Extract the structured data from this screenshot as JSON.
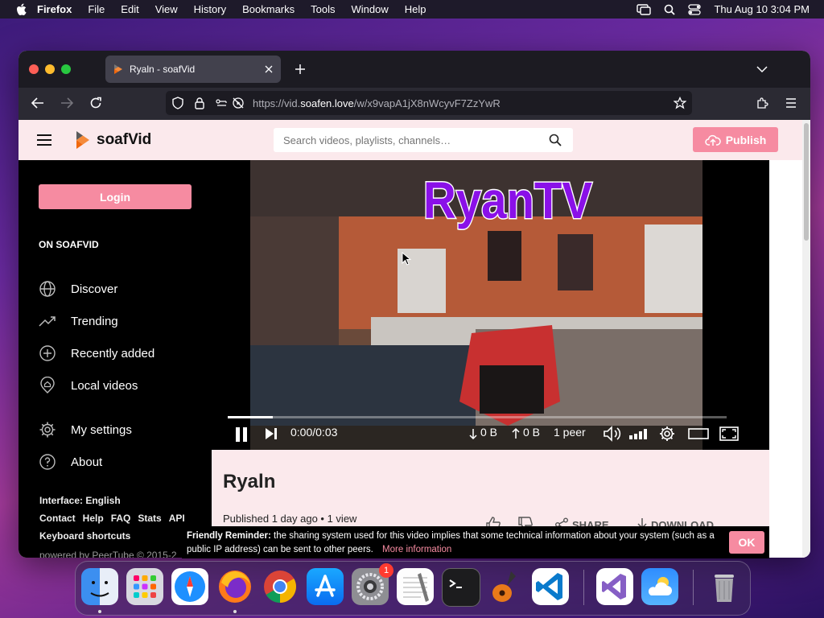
{
  "menubar": {
    "app": "Firefox",
    "items": [
      "File",
      "Edit",
      "View",
      "History",
      "Bookmarks",
      "Tools",
      "Window",
      "Help"
    ],
    "datetime": "Thu Aug 10  3:04 PM"
  },
  "tab": {
    "title": "Ryaln - soafVid",
    "new_tab": "+"
  },
  "url": {
    "prefix": "https://vid.",
    "host": "soafen.love",
    "path": "/w/x9vapA1jX8nWcyvF7ZzYwR"
  },
  "header": {
    "logo_text": "soafVid",
    "search_placeholder": "Search videos, playlists, channels…",
    "publish_label": "Publish"
  },
  "sidebar": {
    "login_label": "Login",
    "section_title": "ON SOAFVID",
    "nav": [
      {
        "label": "Discover",
        "icon": "globe-icon"
      },
      {
        "label": "Trending",
        "icon": "trending-icon"
      },
      {
        "label": "Recently added",
        "icon": "plus-circle-icon"
      },
      {
        "label": "Local videos",
        "icon": "home-pin-icon"
      }
    ],
    "settings_label": "My settings",
    "about_label": "About",
    "interface_label": "Interface: English",
    "footer_links": [
      "Contact",
      "Help",
      "FAQ",
      "Stats",
      "API"
    ],
    "keyboard_label": "Keyboard shortcuts",
    "powered_by": "powered by PeerTube © 2015-2"
  },
  "video": {
    "overlay_title": "RyanTV",
    "time": "0:00/0:03",
    "progress": 0.09,
    "download_stat": "0 B",
    "upload_stat": "0 B",
    "peers": "1 peer",
    "title": "Ryaln",
    "meta": "Published 1 day ago • 1 view",
    "share_label": "SHARE",
    "download_label": "DOWNLOAD"
  },
  "reminder": {
    "bold": "Friendly Reminder:",
    "text": " the sharing system used for this video implies that some technical information about your system (such as a public IP address) can be sent to other peers.",
    "link": "More information",
    "ok": "OK"
  },
  "dock": {
    "apps": [
      "finder-icon",
      "launchpad-icon",
      "safari-icon",
      "firefox-icon",
      "chrome-icon",
      "app-store-icon",
      "system-settings-icon",
      "textedit-icon",
      "terminal-icon",
      "garageband-icon",
      "vscode-icon",
      "visual-studio-icon",
      "weather-icon",
      "trash-icon"
    ],
    "settings_badge": "1"
  },
  "colors": {
    "accent": "#f68ba1",
    "header_bg": "#fbe9ec",
    "title_purple": "#8a10e8"
  }
}
